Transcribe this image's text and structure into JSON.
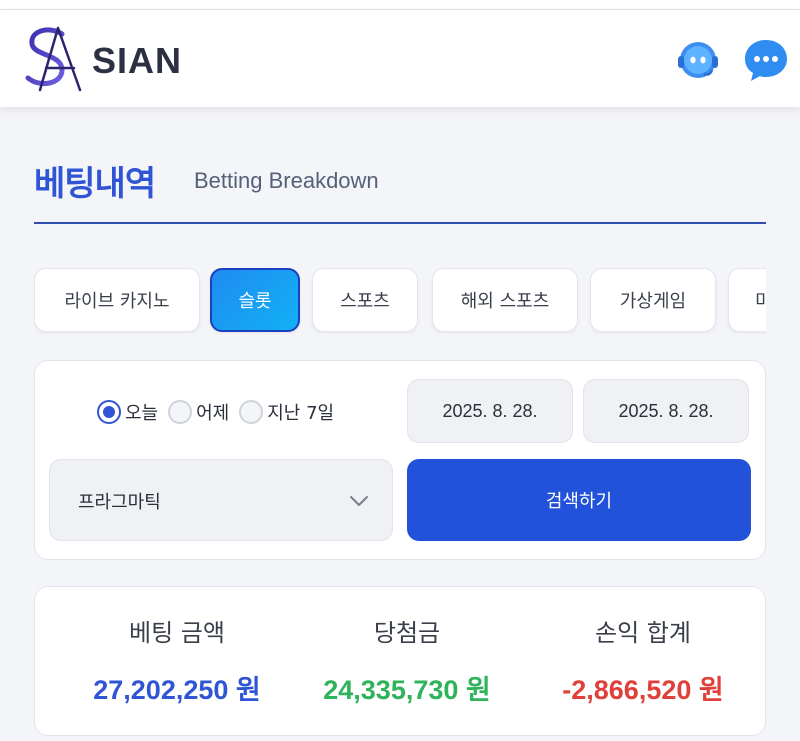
{
  "header": {
    "brand": "SIAN",
    "logo_icon": "sian-logo-icon",
    "support_icon": "support-bot-icon",
    "chat_icon": "chat-bubble-icon"
  },
  "page": {
    "title_ko": "베팅내역",
    "title_en": "Betting Breakdown"
  },
  "tabs": [
    {
      "label": "라이브 카지노",
      "active": false
    },
    {
      "label": "슬롯",
      "active": true
    },
    {
      "label": "스포츠",
      "active": false
    },
    {
      "label": "해외 스포츠",
      "active": false
    },
    {
      "label": "가상게임",
      "active": false
    },
    {
      "label": "미",
      "active": false
    }
  ],
  "filters": {
    "period_options": [
      {
        "label": "오늘",
        "selected": true
      },
      {
        "label": "어제",
        "selected": false
      },
      {
        "label": "지난 7일",
        "selected": false
      }
    ],
    "date_from": "2025. 8. 28.",
    "date_to": "2025. 8. 28.",
    "provider": "프라그마틱",
    "search_label": "검색하기"
  },
  "summary": {
    "bet_label": "베팅 금액",
    "bet_value": "27,202,250 원",
    "win_label": "당첨금",
    "win_value": "24,335,730 원",
    "pl_label": "손익 합계",
    "pl_value": "-2,866,520 원"
  },
  "colors": {
    "accent": "#2f55d4",
    "search_button": "#2152d9",
    "bet_value": "#2f55d4",
    "win_value": "#2eb35a",
    "pl_value": "#e0403a"
  }
}
